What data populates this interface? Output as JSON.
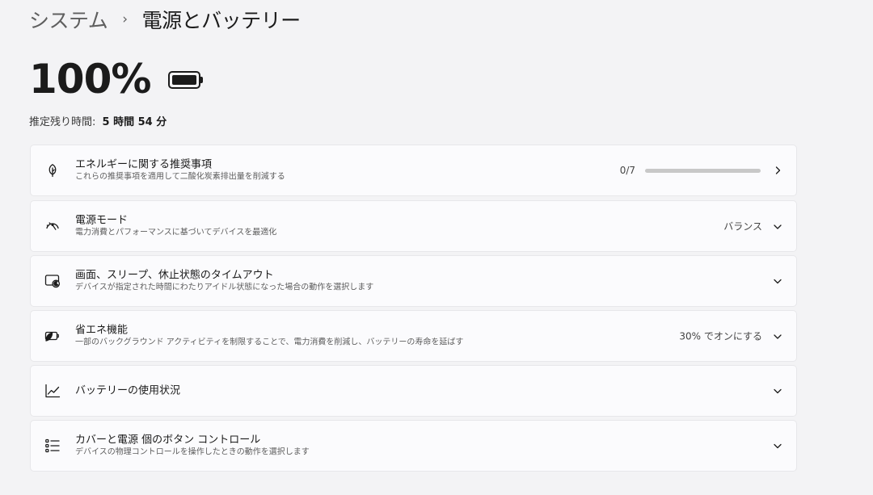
{
  "breadcrumb": {
    "parent": "システム",
    "separator": "›",
    "current": "電源とバッテリー"
  },
  "battery": {
    "percent_label": "100%",
    "level": 1.0,
    "remaining_label": "推定残り時間:",
    "remaining_value": "5 時間 54 分"
  },
  "cards": [
    {
      "title": "エネルギーに関する推奨事項",
      "subtitle": "これらの推奨事項を適用して二酸化炭素排出量を削減する",
      "value": "0/7",
      "progress": 0,
      "icon": "leaf-icon",
      "chevron": "chevron-right-icon"
    },
    {
      "title": "電源モード",
      "subtitle": "電力消費とパフォーマンスに基づいてデバイスを最適化",
      "value": "バランス",
      "icon": "power-mode-icon",
      "chevron": "chevron-down-icon"
    },
    {
      "title": "画面、スリープ、休止状態のタイムアウト",
      "subtitle": "デバイスが指定された時間にわたりアイドル状態になった場合の動作を選択します",
      "icon": "screen-sleep-icon",
      "chevron": "chevron-down-icon"
    },
    {
      "title": "省エネ機能",
      "subtitle": "一部のバックグラウンド アクティビティを制限することで、電力消費を削減し、バッテリーの寿命を延ばす",
      "value": "30% でオンにする",
      "icon": "battery-saver-icon",
      "chevron": "chevron-down-icon"
    },
    {
      "title": "バッテリーの使用状況",
      "icon": "usage-chart-icon",
      "chevron": "chevron-down-icon"
    },
    {
      "title": "カバーと電源 個のボタン コントロール",
      "subtitle": "デバイスの物理コントロールを操作したときの動作を選択します",
      "icon": "button-controls-icon",
      "chevron": "chevron-down-icon"
    }
  ],
  "colors": {
    "background": "#f3f3f5",
    "card": "#fbfbfd",
    "text": "#1b1b1b",
    "subtext": "#5d5d5d",
    "accent": "#0067c0"
  }
}
